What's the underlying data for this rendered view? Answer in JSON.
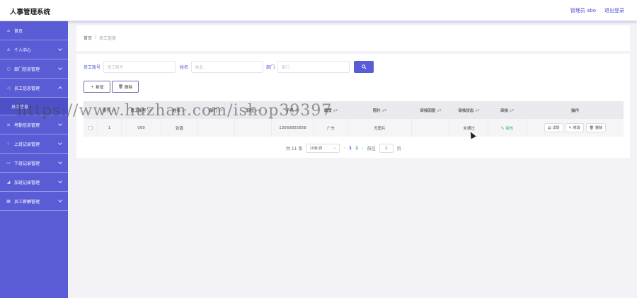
{
  "app": {
    "title": "人事管理系统"
  },
  "topbar": {
    "user_label": "管理员 abo",
    "logout_label": "退出登录"
  },
  "sidebar": {
    "items": [
      {
        "label": "首页",
        "icon": "home-icon",
        "glyph": "⌂"
      },
      {
        "label": "个人中心",
        "icon": "user-icon",
        "glyph": "♙"
      },
      {
        "label": "部门信息管理",
        "icon": "chat-icon",
        "glyph": "○"
      },
      {
        "label": "员工信息管理",
        "icon": "send-icon",
        "glyph": "◁"
      },
      {
        "label": "员工信息",
        "sub": true
      },
      {
        "label": "考勤信息管理",
        "icon": "list-icon",
        "glyph": "≡"
      },
      {
        "label": "上班记录管理",
        "icon": "bell-icon",
        "glyph": "♢"
      },
      {
        "label": "下班记录管理",
        "icon": "message-icon",
        "glyph": "▭"
      },
      {
        "label": "加班记录管理",
        "icon": "chart-icon",
        "glyph": "◢"
      },
      {
        "label": "员工薪酬管理",
        "icon": "grid-icon",
        "glyph": "▦"
      }
    ]
  },
  "breadcrumb": {
    "home": "首页",
    "separator": "/",
    "current": "员工信息"
  },
  "search": {
    "employee_no_label": "员工账号",
    "employee_no_placeholder": "员工账号",
    "name_label": "姓名",
    "name_placeholder": "姓名",
    "dept_label": "部门",
    "dept_placeholder": "部门",
    "button_icon": "search-icon"
  },
  "actions": {
    "add_label": "新增",
    "delete_label": "删除"
  },
  "table": {
    "headers": [
      "索引",
      "员工账号",
      "姓名",
      "部门",
      "职位",
      "手机",
      "籍贯",
      "照片",
      "审核回复",
      "审核状态",
      "审核",
      "操作"
    ],
    "rows": [
      {
        "index": "1",
        "employee_no": "009",
        "name": "张嘉",
        "dept": "",
        "position": "",
        "phone": "13569855858",
        "hometown": "广东",
        "photo": "无图片",
        "audit_reply": "",
        "audit_status": "未通过",
        "audit_action": "审核",
        "op_detail": "详情",
        "op_edit": "修改",
        "op_delete": "删除"
      }
    ]
  },
  "pagination": {
    "total_text": "共 11 条",
    "page_size": "10条/页",
    "pages": [
      "1",
      "2"
    ],
    "current_page": 2,
    "goto_label": "前往",
    "goto_value": "2",
    "page_suffix": "页"
  },
  "watermark": {
    "text": "https://www.huzhan.com/ishop39397"
  },
  "colors": {
    "accent": "#5a5cd6",
    "success": "#3cb371",
    "sidebar_bg": "#5a5cd6"
  }
}
